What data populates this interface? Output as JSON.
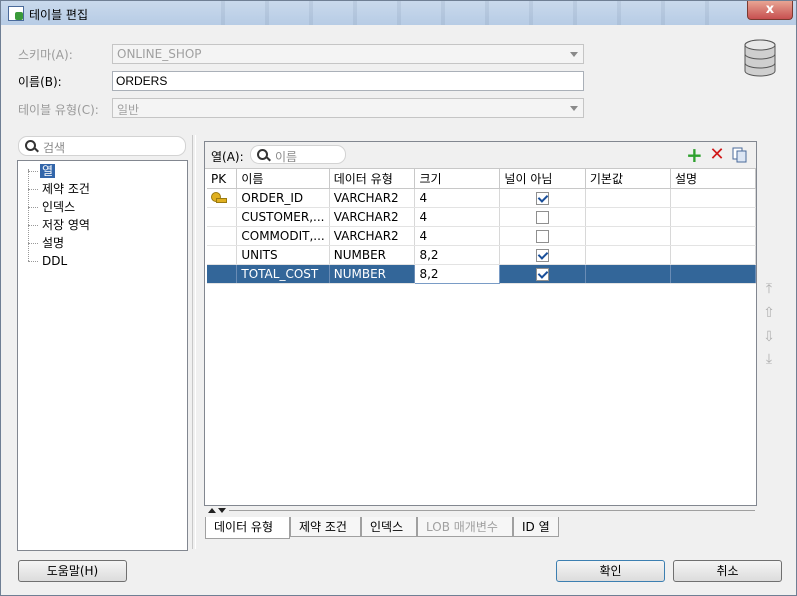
{
  "window": {
    "title": "테이블 편집",
    "close_label": "x"
  },
  "schema": {
    "label": "스키마(A):",
    "value": "ONLINE_SHOP"
  },
  "name": {
    "label": "이름(B):",
    "value": "ORDERS"
  },
  "table_type": {
    "label": "테이블 유형(C):",
    "value": "일반"
  },
  "nav": {
    "search_placeholder": "검색",
    "items": [
      "열",
      "제약 조건",
      "인덱스",
      "저장 영역",
      "설명",
      "DDL"
    ],
    "selected": "열"
  },
  "columns_panel": {
    "label": "열(A):",
    "search_placeholder": "이름",
    "add_icon": "plus-icon",
    "remove_icon": "delete-x-icon",
    "copy_icon": "copy-icon"
  },
  "grid": {
    "headers": [
      "PK",
      "이름",
      "데이터 유형",
      "크기",
      "널이 아님",
      "기본값",
      "설명"
    ],
    "rows": [
      {
        "pk": true,
        "name": "ORDER_ID",
        "type": "VARCHAR2",
        "size": "4",
        "not_null": true,
        "default": "",
        "comment": ""
      },
      {
        "pk": false,
        "name": "CUSTOMER,...",
        "type": "VARCHAR2",
        "size": "4",
        "not_null": false,
        "default": "",
        "comment": ""
      },
      {
        "pk": false,
        "name": "COMMODIT,...",
        "type": "VARCHAR2",
        "size": "4",
        "not_null": false,
        "default": "",
        "comment": ""
      },
      {
        "pk": false,
        "name": "UNITS",
        "type": "NUMBER",
        "size": "8,2",
        "not_null": true,
        "default": "",
        "comment": ""
      },
      {
        "pk": false,
        "name": "TOTAL_COST",
        "type": "NUMBER",
        "size": "8,2",
        "not_null": true,
        "default": "",
        "comment": ""
      }
    ],
    "selected_row": 4
  },
  "move_buttons": [
    "move-top-icon",
    "move-up-icon",
    "move-down-icon",
    "move-bottom-icon"
  ],
  "tabs": [
    "데이터 유형",
    "제약 조건",
    "인덱스",
    "LOB 매개변수",
    "ID 열"
  ],
  "buttons": {
    "help": "도움말(H)",
    "ok": "확인",
    "cancel": "취소"
  }
}
